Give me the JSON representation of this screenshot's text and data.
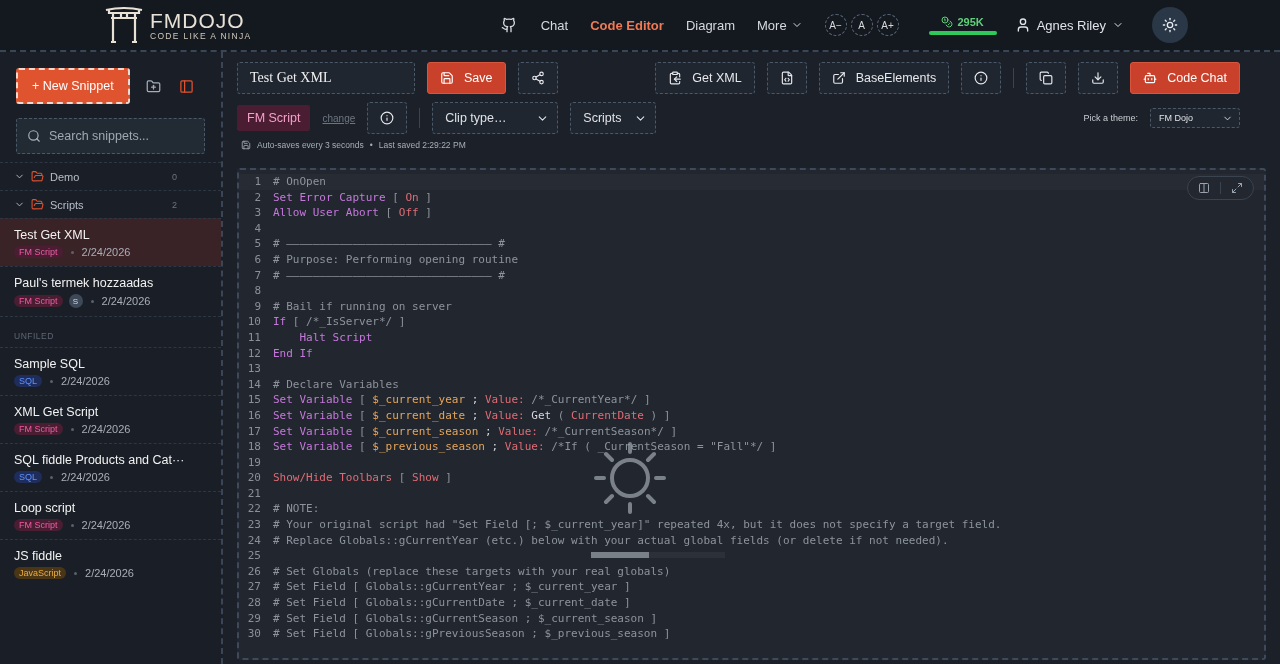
{
  "header": {
    "logo_title": "FMDOJO",
    "logo_tagline": "CODE LIKE A NINJA",
    "nav": [
      {
        "kind": "link",
        "label": "Chat",
        "selected": false
      },
      {
        "kind": "link",
        "label": "Code Editor",
        "selected": true
      },
      {
        "kind": "link",
        "label": "Diagram",
        "selected": false
      },
      {
        "kind": "menu",
        "label": "More",
        "selected": false
      }
    ],
    "font_sizes": [
      "A−",
      "A",
      "A+"
    ],
    "credits": {
      "label": "295K",
      "level": 1
    },
    "user": {
      "name": "Agnes Riley"
    }
  },
  "sidebar": {
    "new_button": "+ New Snippet",
    "search": {
      "placeholder": "Search snippets..."
    },
    "folders": [
      {
        "name": "Demo",
        "count": "0",
        "expanded": true
      },
      {
        "name": "Scripts",
        "count": "2",
        "expanded": true,
        "children": [
          {
            "title": "Test Get XML",
            "tag": "FM Script",
            "color": "#4a1d33",
            "date": "2/24/2026",
            "selected": true
          },
          {
            "title": "Paul's termek hozzaadas",
            "tag": "FM Script",
            "color": "#4a1d33",
            "avatar": "S",
            "date": "2/24/2026",
            "selected": false
          }
        ]
      }
    ],
    "section_label": "UNFILED",
    "snippets": [
      {
        "title": "Sample SQL",
        "tag": "SQL",
        "color": "#1e2d5c",
        "date": "2/24/2026",
        "selected": false
      },
      {
        "title": "XML Get Script",
        "tag": "FM Script",
        "color": "#4a1d33",
        "date": "2/24/2026",
        "selected": false
      },
      {
        "title": "SQL fiddle Products and Cat···",
        "tag": "SQL",
        "color": "#1e2d5c",
        "date": "2/24/2026",
        "selected": false
      },
      {
        "title": "Loop script",
        "tag": "FM Script",
        "color": "#4a1d33",
        "date": "2/24/2026",
        "selected": false
      },
      {
        "title": "JS fiddle",
        "tag": "JavaScript",
        "color": "#4a3514",
        "date": "2/24/2026",
        "selected": false
      }
    ]
  },
  "toolbar": {
    "title_field": "Test Get XML",
    "save": "Save",
    "get_xml": "Get XML",
    "base_elements": "BaseElements",
    "code_chat": "Code Chat",
    "language": "FM Script",
    "change_link": "change",
    "clip_type": "Clip type…",
    "category": "Scripts",
    "theme_label": "Pick a theme:",
    "theme": "FM Dojo",
    "status": {
      "autosave": "Auto-saves every 3 seconds",
      "separator": "•",
      "last_saved": "Last saved 2:29:22 PM"
    }
  },
  "editor": {
    "lines": [
      {
        "n": "1",
        "tokens": [
          {
            "kind": "comment",
            "t": "# OnOpen"
          }
        ]
      },
      {
        "n": "2",
        "tokens": [
          {
            "kind": "keyword",
            "t": "Set Error Capture"
          },
          {
            "kind": "punct",
            "t": " [ "
          },
          {
            "kind": "value",
            "t": "On"
          },
          {
            "kind": "punct",
            "t": " ]"
          }
        ]
      },
      {
        "n": "3",
        "tokens": [
          {
            "kind": "keyword",
            "t": "Allow User Abort"
          },
          {
            "kind": "punct",
            "t": " [ "
          },
          {
            "kind": "value",
            "t": "Off"
          },
          {
            "kind": "punct",
            "t": " ]"
          }
        ]
      },
      {
        "n": "4"
      },
      {
        "n": "5",
        "tokens": [
          {
            "kind": "comment",
            "t": "# ——————————————————————————————— #"
          }
        ]
      },
      {
        "n": "6",
        "tokens": [
          {
            "kind": "comment",
            "t": "# Purpose: Performing opening routine"
          }
        ]
      },
      {
        "n": "7",
        "tokens": [
          {
            "kind": "comment",
            "t": "# ——————————————————————————————— #"
          }
        ]
      },
      {
        "n": "8"
      },
      {
        "n": "9",
        "tokens": [
          {
            "kind": "comment",
            "t": "# Bail if running on server"
          }
        ]
      },
      {
        "n": "10",
        "tokens": [
          {
            "kind": "keyword",
            "t": "If"
          },
          {
            "kind": "punct",
            "t": " [ /*_IsServer*/ ]"
          }
        ]
      },
      {
        "n": "11",
        "tokens": [
          {
            "kind": "keyword",
            "t": "    Halt Script"
          }
        ]
      },
      {
        "n": "12",
        "tokens": [
          {
            "kind": "keyword",
            "t": "End If"
          }
        ]
      },
      {
        "n": "13"
      },
      {
        "n": "14",
        "tokens": [
          {
            "kind": "comment",
            "t": "# Declare Variables"
          }
        ]
      },
      {
        "n": "15",
        "tokens": [
          {
            "kind": "keyword",
            "t": "Set Variable"
          },
          {
            "kind": "punct",
            "t": " [ "
          },
          {
            "kind": "var",
            "t": "$_current_year"
          },
          {
            "kind": "plain",
            "t": " ; "
          },
          {
            "kind": "value",
            "t": "Value:"
          },
          {
            "kind": "punct",
            "t": " /*_CurrentYear*/ ]"
          }
        ]
      },
      {
        "n": "16",
        "tokens": [
          {
            "kind": "keyword",
            "t": "Set Variable"
          },
          {
            "kind": "punct",
            "t": " [ "
          },
          {
            "kind": "var",
            "t": "$_current_date"
          },
          {
            "kind": "plain",
            "t": " ; "
          },
          {
            "kind": "value",
            "t": "Value:"
          },
          {
            "kind": "plain",
            "t": " Get "
          },
          {
            "kind": "punct",
            "t": "( "
          },
          {
            "kind": "value",
            "t": "CurrentDate"
          },
          {
            "kind": "punct",
            "t": " ) ]"
          }
        ]
      },
      {
        "n": "17",
        "tokens": [
          {
            "kind": "keyword",
            "t": "Set Variable"
          },
          {
            "kind": "punct",
            "t": " [ "
          },
          {
            "kind": "var",
            "t": "$_current_season"
          },
          {
            "kind": "plain",
            "t": " ; "
          },
          {
            "kind": "value",
            "t": "Value:"
          },
          {
            "kind": "punct",
            "t": " /*_CurrentSeason*/ ]"
          }
        ]
      },
      {
        "n": "18",
        "tokens": [
          {
            "kind": "keyword",
            "t": "Set Variable"
          },
          {
            "kind": "punct",
            "t": " [ "
          },
          {
            "kind": "var",
            "t": "$_previous_season"
          },
          {
            "kind": "plain",
            "t": " ; "
          },
          {
            "kind": "value",
            "t": "Value:"
          },
          {
            "kind": "punct",
            "t": " /*If ( _CurrentSeason = \"Fall\"*/ ]"
          }
        ]
      },
      {
        "n": "19"
      },
      {
        "n": "20",
        "tokens": [
          {
            "kind": "value",
            "t": "Show/Hide Toolbars"
          },
          {
            "kind": "punct",
            "t": " [ "
          },
          {
            "kind": "value",
            "t": "Show"
          },
          {
            "kind": "punct",
            "t": " ]"
          }
        ]
      },
      {
        "n": "21"
      },
      {
        "n": "22",
        "tokens": [
          {
            "kind": "comment",
            "t": "# NOTE:"
          }
        ]
      },
      {
        "n": "23",
        "tokens": [
          {
            "kind": "comment",
            "t": "# Your original script had \"Set Field [; $_current_year]\" repeated 4x, but it does not specify a target field."
          }
        ]
      },
      {
        "n": "24",
        "tokens": [
          {
            "kind": "comment",
            "t": "# Replace Globals::gCurrentYear (etc.) below with your actual global fields (or delete if not needed)."
          }
        ]
      },
      {
        "n": "25"
      },
      {
        "n": "26",
        "tokens": [
          {
            "kind": "comment",
            "t": "# Set Globals (replace these targets with your real globals)"
          }
        ]
      },
      {
        "n": "27",
        "tokens": [
          {
            "kind": "comment",
            "t": "# Set Field [ Globals::gCurrentYear ; $_current_year ]"
          }
        ]
      },
      {
        "n": "28",
        "tokens": [
          {
            "kind": "comment",
            "t": "# Set Field [ Globals::gCurrentDate ; $_current_date ]"
          }
        ]
      },
      {
        "n": "29",
        "tokens": [
          {
            "kind": "comment",
            "t": "# Set Field [ Globals::gCurrentSeason ; $_current_season ]"
          }
        ]
      },
      {
        "n": "30",
        "tokens": [
          {
            "kind": "comment",
            "t": "# Set Field [ Globals::gPreviousSeason ; $_previous_season ]"
          }
        ]
      }
    ],
    "loading": true
  }
}
